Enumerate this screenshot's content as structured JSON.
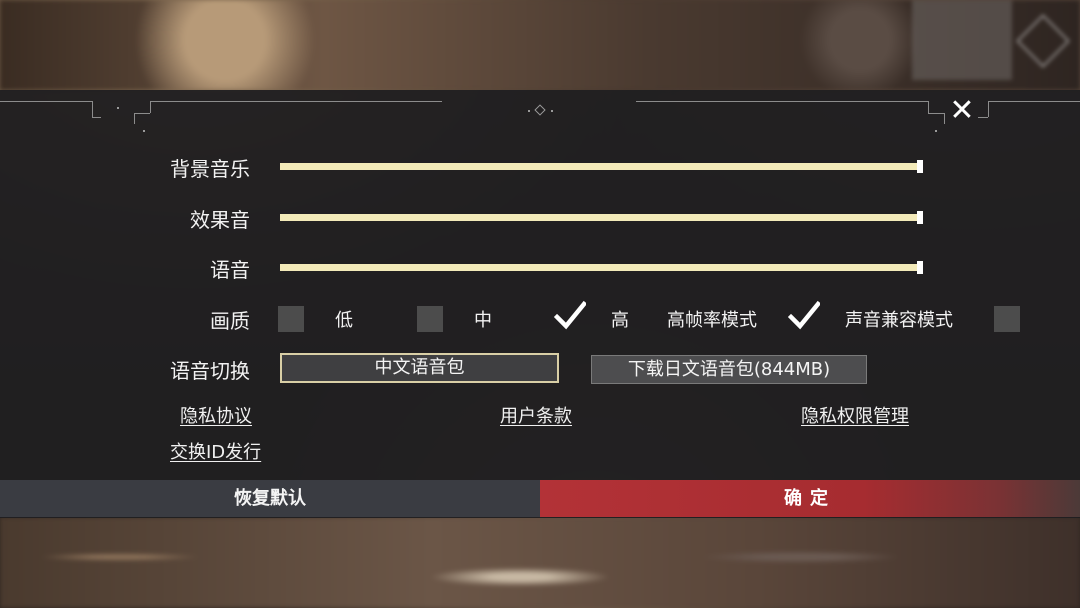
{
  "colors": {
    "slider": "#f3eab9",
    "confirm": "#b33237",
    "reset": "#3a3c42",
    "active_border": "#d9cfa6"
  },
  "close": {
    "icon": "close-icon",
    "glyph": "✕"
  },
  "audio": {
    "bgm": {
      "label": "背景音乐",
      "value": 1.0
    },
    "sfx": {
      "label": "效果音",
      "value": 1.0
    },
    "voice": {
      "label": "语音",
      "value": 1.0
    }
  },
  "quality": {
    "label": "画质",
    "options": [
      {
        "label": "低",
        "checked": false
      },
      {
        "label": "中",
        "checked": false
      },
      {
        "label": "高",
        "checked": true
      },
      {
        "label": "高帧率模式",
        "checked": true
      },
      {
        "label": "声音兼容模式",
        "checked": false
      }
    ]
  },
  "voice_switch": {
    "label": "语音切换",
    "chinese": "中文语音包",
    "japanese": "下载日文语音包(844MB)"
  },
  "links": {
    "privacy": "隐私协议",
    "terms": "用户条款",
    "permissions": "隐私权限管理",
    "transfer": "交换ID发行"
  },
  "footer": {
    "reset": "恢复默认",
    "confirm": "确定"
  }
}
